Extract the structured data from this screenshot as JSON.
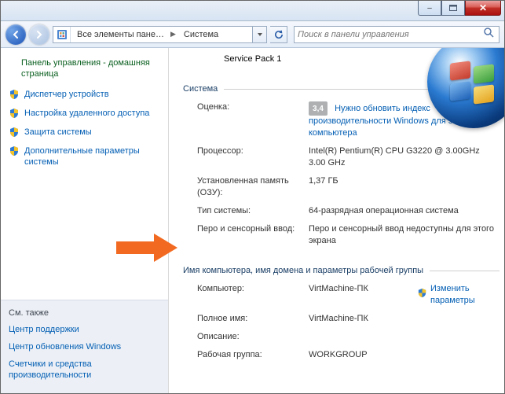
{
  "titlebar": {
    "minimize": "–",
    "maximize": "▢",
    "close": "✕"
  },
  "nav": {
    "breadcrumb": {
      "segment1": "Все элементы пане…",
      "segment2": "Система"
    },
    "search_placeholder": "Поиск в панели управления"
  },
  "sidebar": {
    "home": "Панель управления - домашняя страница",
    "items": [
      "Диспетчер устройств",
      "Настройка удаленного доступа",
      "Защита системы",
      "Дополнительные параметры системы"
    ],
    "see_also_title": "См. также",
    "see_also": [
      "Центр поддержки",
      "Центр обновления Windows",
      "Счетчики и средства производительности"
    ]
  },
  "content": {
    "service_pack": "Service Pack 1",
    "system_legend": "Система",
    "system": {
      "rating_key": "Оценка:",
      "rating_badge": "3,4",
      "rating_link": "Нужно обновить индекс производительности Windows для этого компьютера",
      "cpu_key": "Процессор:",
      "cpu_val": "Intel(R) Pentium(R) CPU G3220 @ 3.00GHz   3.00 GHz",
      "ram_key": "Установленная память (ОЗУ):",
      "ram_val": "1,37 ГБ",
      "type_key": "Тип системы:",
      "type_val": "64-разрядная операционная система",
      "pen_key": "Перо и сенсорный ввод:",
      "pen_val": "Перо и сенсорный ввод недоступны для этого экрана"
    },
    "domain_legend": "Имя компьютера, имя домена и параметры рабочей группы",
    "domain": {
      "computer_key": "Компьютер:",
      "computer_val": "VirtMachine-ПК",
      "change_link": "Изменить параметры",
      "full_key": "Полное имя:",
      "full_val": "VirtMachine-ПК",
      "desc_key": "Описание:",
      "desc_val": "",
      "wg_key": "Рабочая группа:",
      "wg_val": "WORKGROUP"
    }
  }
}
